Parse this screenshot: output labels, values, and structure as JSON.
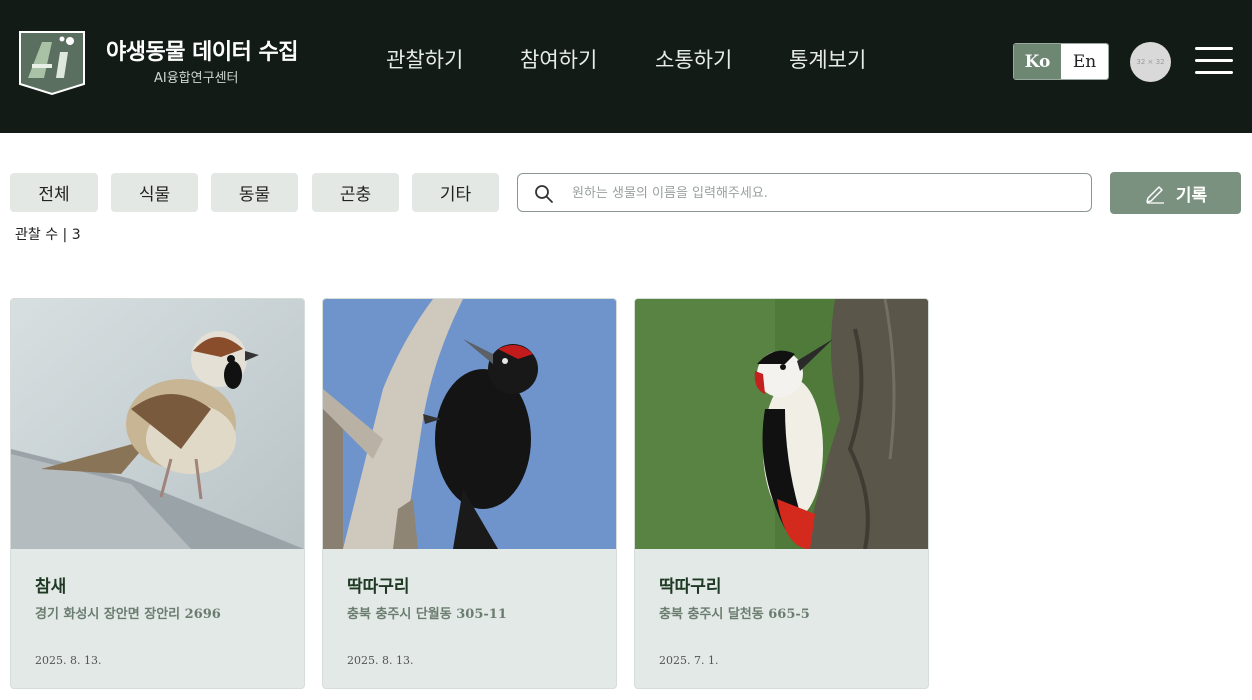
{
  "header": {
    "brand_title": "야생동물 데이터 수집",
    "brand_sub": "AI융합연구센터",
    "logo_text": "Ai",
    "nav": [
      "관찰하기",
      "참여하기",
      "소통하기",
      "통계보기"
    ],
    "lang_ko": "Ko",
    "lang_en": "En",
    "avatar_text": "32 × 32",
    "menu_icon": "hamburger-icon"
  },
  "filters": {
    "chips": [
      "전체",
      "식물",
      "동물",
      "곤충",
      "기타"
    ],
    "search_placeholder": "원하는 생물의 이름을 입력해주세요.",
    "search_value": "",
    "record_label": "기록",
    "count_label": "관찰 수 | 3"
  },
  "cards": [
    {
      "name": "참새",
      "address": "경기 화성시 장안면 장안리 2696",
      "date": "2025. 8. 13."
    },
    {
      "name": "딱따구리",
      "address": "충북 충주시 단월동 305-11",
      "date": "2025. 8. 13."
    },
    {
      "name": "딱따구리",
      "address": "충북 충주시 달천동 665-5",
      "date": "2025. 7. 1."
    }
  ],
  "colors": {
    "header_bg": "#131b17",
    "accent": "#7b917f",
    "chip_bg": "#e3e8e5",
    "card_bg": "#e3e9e6"
  }
}
